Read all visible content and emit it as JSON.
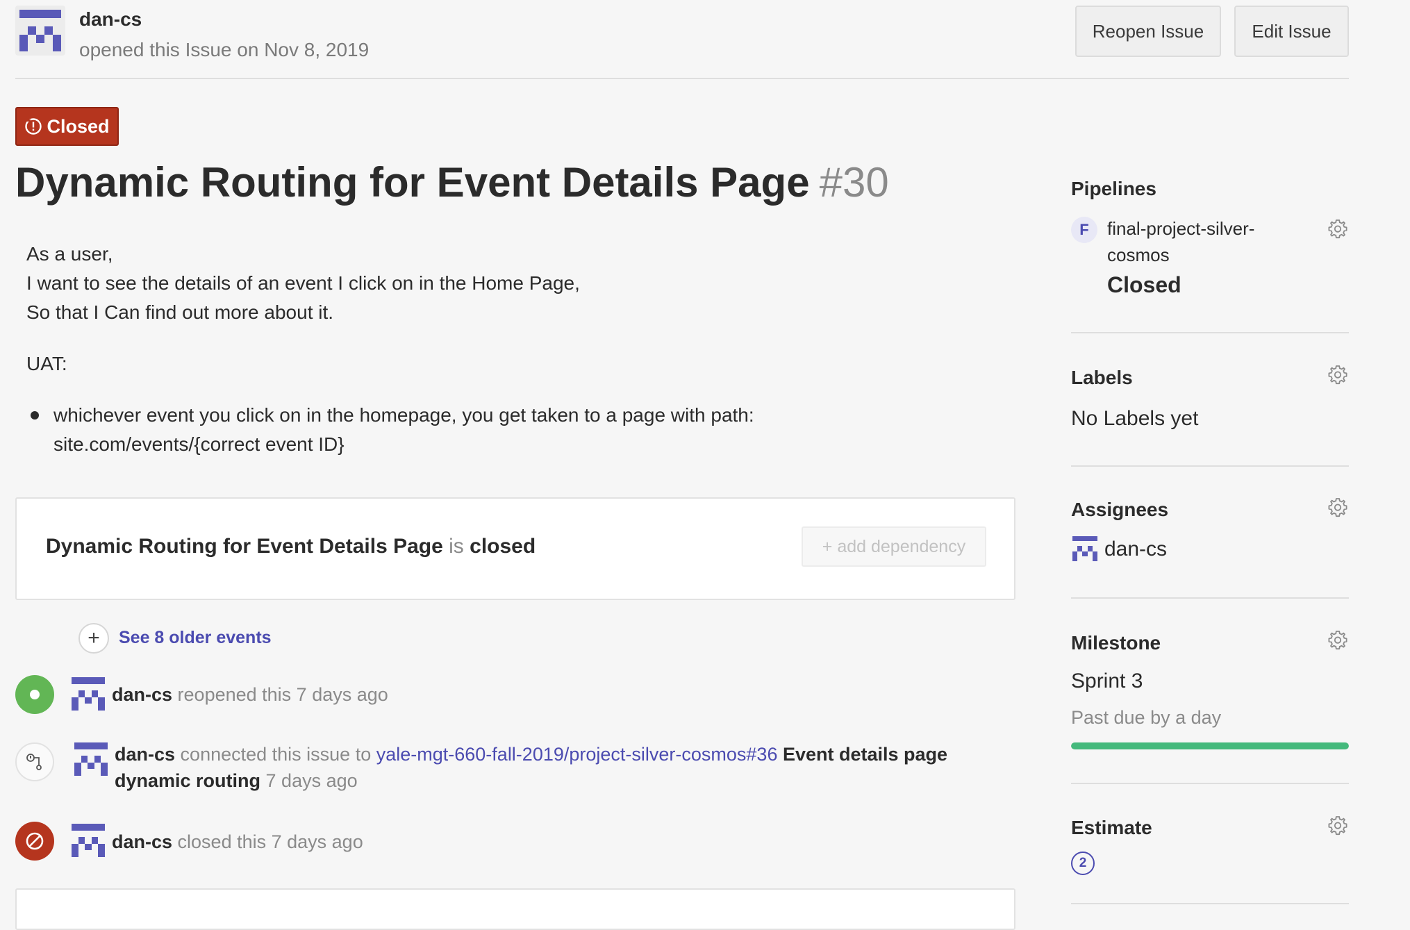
{
  "header": {
    "author": "dan-cs",
    "meta": "opened this Issue on Nov 8, 2019",
    "reopen_label": "Reopen Issue",
    "edit_label": "Edit Issue"
  },
  "issue": {
    "status": "Closed",
    "title": "Dynamic Routing for Event Details Page",
    "number": "#30",
    "body_lines": [
      "As a user,",
      "I want to see the details of an event I click on in the Home Page,",
      "So that I Can find out more about it."
    ],
    "uat_label": "UAT:",
    "bullet_lines": [
      "whichever event you click on in the homepage, you get taken to a page with path:",
      "site.com/events/{correct event ID}"
    ]
  },
  "dependency": {
    "title": "Dynamic Routing for Event Details Page",
    "is": "is",
    "state": "closed",
    "add_label": "+ add dependency"
  },
  "timeline": {
    "older_plus": "+",
    "older_label": "See 8 older events",
    "events": [
      {
        "user": "dan-cs",
        "action": "reopened this 7 days ago",
        "icon": "reopened-dot-icon",
        "color": "#62b655"
      },
      {
        "user": "dan-cs",
        "action": "connected this issue to",
        "link": "yale-mgt-660-fall-2019/project-silver-cosmos#36",
        "link_title_1": "Event details page",
        "link_title_2": "dynamic routing",
        "time": "7 days ago",
        "icon": "connect-issue-icon"
      },
      {
        "user": "dan-cs",
        "action": "closed this 7 days ago",
        "icon": "closed-ban-icon",
        "color": "#b5351e"
      }
    ]
  },
  "sidebar": {
    "pipelines": {
      "title": "Pipelines",
      "badge": "F",
      "name_line1": "final-project-silver-",
      "name_line2": "cosmos",
      "state": "Closed"
    },
    "labels": {
      "title": "Labels",
      "empty": "No Labels yet"
    },
    "assignees": {
      "title": "Assignees",
      "user": "dan-cs"
    },
    "milestone": {
      "title": "Milestone",
      "name": "Sprint 3",
      "due": "Past due by a day",
      "progress": 1.0,
      "progress_color": "#44b97c"
    },
    "estimate": {
      "title": "Estimate",
      "value": "2"
    }
  },
  "colors": {
    "accent": "#4b4bb0",
    "closed_red": "#b5351e",
    "open_green": "#62b655",
    "avatar": "#5a5ab8"
  }
}
